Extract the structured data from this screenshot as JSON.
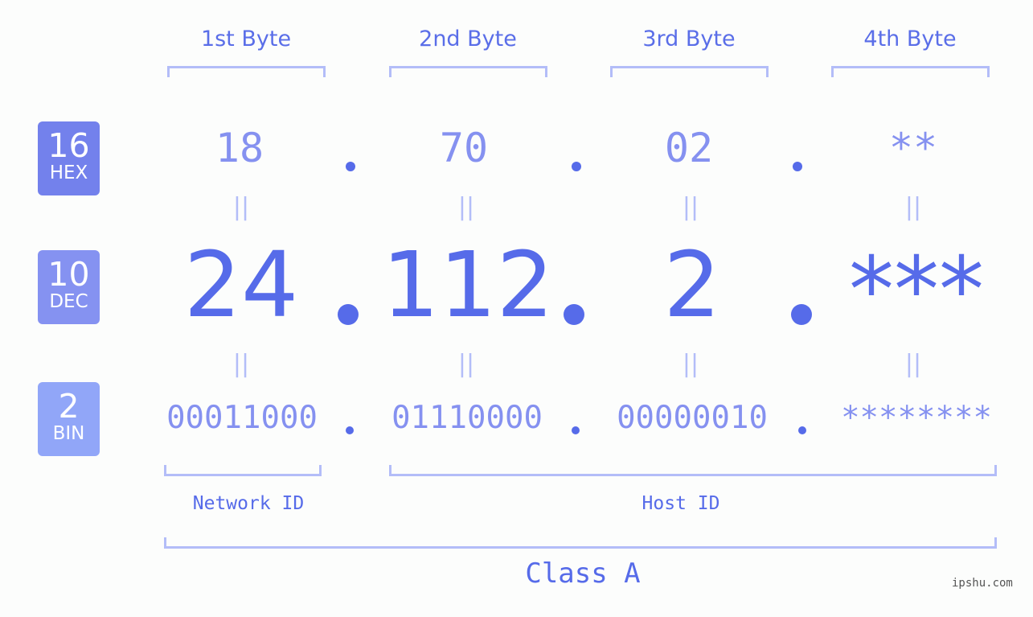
{
  "byte_headers": [
    "1st Byte",
    "2nd Byte",
    "3rd Byte",
    "4th Byte"
  ],
  "badges": {
    "hex": {
      "number": "16",
      "label": "HEX",
      "color": "#7381ec"
    },
    "dec": {
      "number": "10",
      "label": "DEC",
      "color": "#8592f1"
    },
    "bin": {
      "number": "2",
      "label": "BIN",
      "color": "#91a6f8"
    }
  },
  "hex_octets": [
    "18",
    "70",
    "02",
    "**"
  ],
  "dec_octets": [
    "24",
    "112",
    "2",
    "***"
  ],
  "bin_octets": [
    "00011000",
    "01110000",
    "00000010",
    "********"
  ],
  "separator": ".",
  "equals_sign": "||",
  "network_id_label": "Network ID",
  "host_id_label": "Host ID",
  "class_label": "Class A",
  "watermark": "ipshu.com",
  "colors": {
    "accent": "#566be9",
    "light_accent": "#8591f0",
    "bracket": "#b3bdf8"
  }
}
